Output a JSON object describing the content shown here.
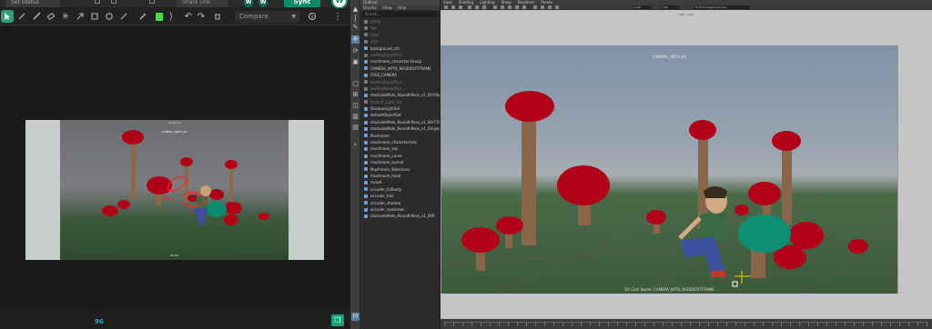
{
  "review": {
    "status_select": "Set Status",
    "share_select": "Share Link",
    "sync_label": "Sync",
    "user_initial": "W",
    "watch_initials": [
      "W",
      "W"
    ],
    "compare_select": "Compare",
    "draw_color": "#3ee33e",
    "frame_number": "96",
    "frame": {
      "timecode": "00:00:10",
      "camera_label": "CAMERA_ORTH_00",
      "footer": "00:00"
    },
    "tools": [
      "select-icon",
      "pen-icon",
      "brush-icon",
      "eraser-icon",
      "laser-icon",
      "arrow-icon",
      "rect-icon",
      "circle-icon",
      "line-icon",
      "eyedropper-icon",
      "undo-icon",
      "redo-icon",
      "delete-icon",
      "info-icon",
      "more-icon"
    ]
  },
  "maya": {
    "outliner": {
      "title": "Outliner",
      "menu": [
        "Display",
        "Show",
        "Help"
      ],
      "search_placeholder": "Search...",
      "items": [
        {
          "label": "persp",
          "dim": true
        },
        {
          "label": "top",
          "dim": true
        },
        {
          "label": "front",
          "dim": true
        },
        {
          "label": "side",
          "dim": true
        },
        {
          "label": "background_ctrl",
          "dim": false
        },
        {
          "label": "lowPolyBodyPhys",
          "dim": true
        },
        {
          "label": "mushroom_character:Group",
          "dim": false
        },
        {
          "label": "CAMERA_WITH_RIGIDSOFTFRAME",
          "dim": false
        },
        {
          "label": "FREE_CAMERA",
          "dim": false
        },
        {
          "label": "lowPolyBodyPhys",
          "dim": true
        },
        {
          "label": "lowPolyBodyPhys",
          "dim": true
        },
        {
          "label": "stockadeMale_RoundhPose_v1_00:Plan",
          "dim": false
        },
        {
          "label": "Default_Light_Set",
          "dim": true
        },
        {
          "label": "ShadowLightSet",
          "dim": false
        },
        {
          "label": "defaultObjectSet",
          "dim": false
        },
        {
          "label": "stockadeMale_RoundhPose_v1_00:CTRL",
          "dim": false
        },
        {
          "label": "stockadeMale_RoundhPose_v1_00:geo",
          "dim": false
        },
        {
          "label": "Mushroom",
          "dim": false
        },
        {
          "label": "mushroom_characterSets",
          "dim": false
        },
        {
          "label": "mushroom_key",
          "dim": false
        },
        {
          "label": "mushroom_curve",
          "dim": false
        },
        {
          "label": "mushroom_tunnel",
          "dim": false
        },
        {
          "label": "Mushroom_Selections",
          "dim": false
        },
        {
          "label": "mushroom_head",
          "dim": false
        },
        {
          "label": "rocket",
          "dim": false
        },
        {
          "label": "occuder_fullbody",
          "dim": false
        },
        {
          "label": "occuder_hair",
          "dim": false
        },
        {
          "label": "occuder_shadow",
          "dim": false
        },
        {
          "label": "occuder_eyebrows",
          "dim": false
        },
        {
          "label": "stockadeMale_RoundhPose_v1_0SR",
          "dim": false
        }
      ]
    },
    "viewport": {
      "menu": [
        "View",
        "Shading",
        "Lighting",
        "Show",
        "Renderer",
        "Panels"
      ],
      "resolution": "960 x 540",
      "camera_label": "CAMERA_ORTH_00",
      "hud": "DA Cam Name: CAMERA_WITH_RIGIDSOFTFRAME",
      "field_a": "0.00",
      "field_b": "1.00",
      "field_c": "lot frmt rmgst frm1-0-0"
    }
  }
}
